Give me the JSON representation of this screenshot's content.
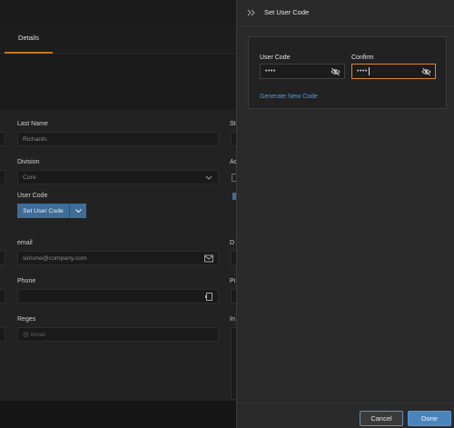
{
  "tabs": {
    "details": "Details"
  },
  "form": {
    "last_name_label": "Last Name",
    "last_name_value": "Richards",
    "division_label": "Division",
    "division_value": "Core",
    "user_code_label": "User Code",
    "set_user_code_button": "Set User Code",
    "email_label": "email",
    "email_value": "simone@company.com",
    "phone_label": "Phone",
    "phone_value": "",
    "reges_label": "Reges",
    "reges_placeholder": "@ email",
    "right_col_labels": [
      "St",
      "Ac",
      "D",
      "Pi",
      "In"
    ]
  },
  "panel": {
    "title": "Set User Code",
    "user_code_label": "User Code",
    "user_code_value": "••••",
    "confirm_label": "Confirm",
    "confirm_value": "••••",
    "generate_link": "Generate New Code",
    "cancel_button": "Cancel",
    "done_button": "Done"
  },
  "colors": {
    "accent_tab": "#c27a22",
    "focus_border": "#d88a2a",
    "primary_button": "#4a84bd",
    "link": "#4e9be0"
  },
  "icons": [
    "collapse-icon",
    "eye-slash-icon",
    "envelope-icon",
    "phone-icon",
    "chevron-down-icon"
  ]
}
